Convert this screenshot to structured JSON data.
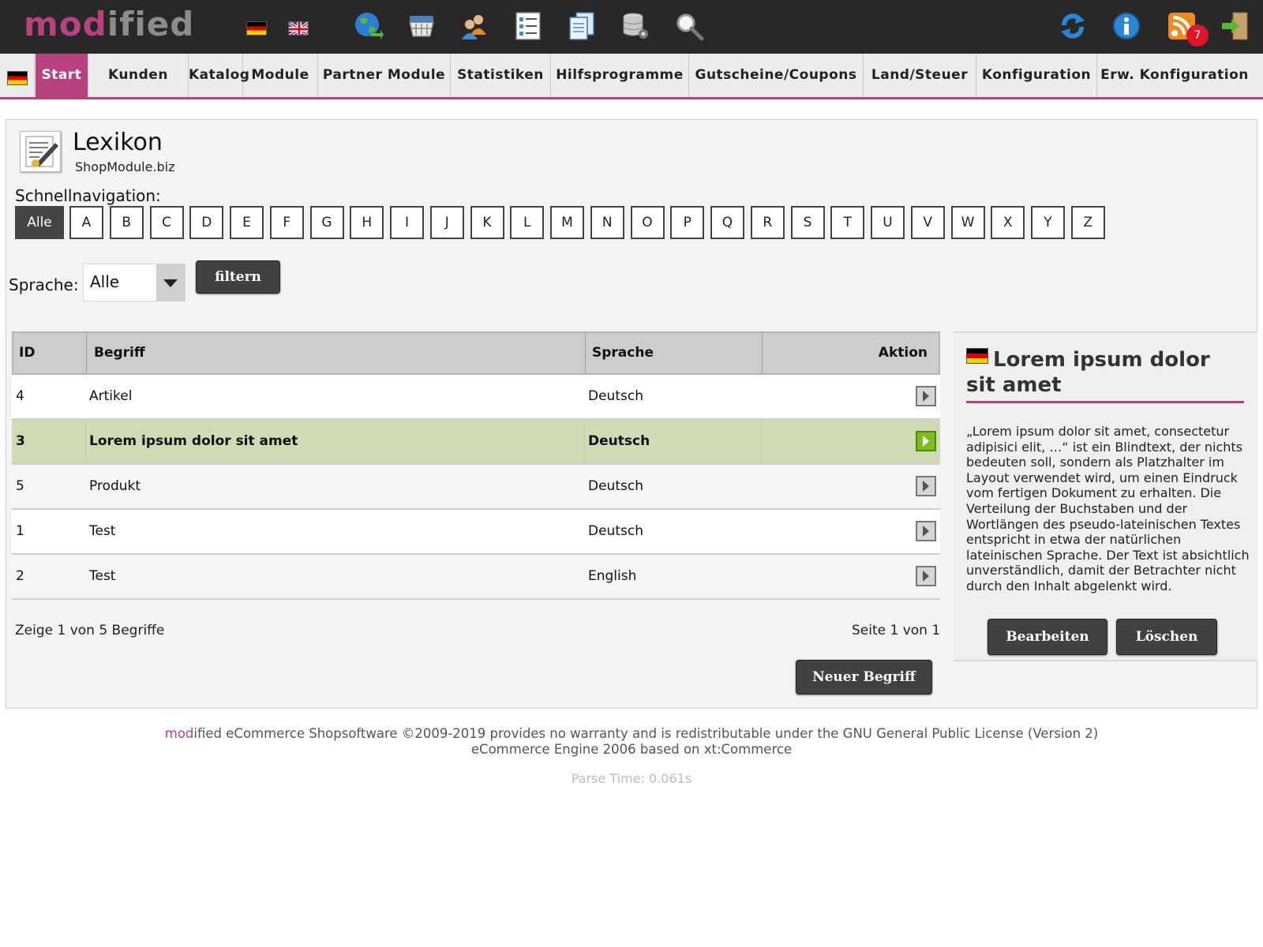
{
  "header": {
    "logo_mod": "mod",
    "logo_ified": "ified",
    "notification_count": "7",
    "icons": [
      "de-flag-icon",
      "uk-flag-icon",
      "globe-icon",
      "basket-icon",
      "users-icon",
      "checklist-icon",
      "documents-icon",
      "database-settings-icon",
      "search-icon",
      "refresh-icon",
      "info-icon",
      "rss-icon",
      "logout-icon"
    ]
  },
  "menu": {
    "items": [
      "Start",
      "Kunden",
      "Katalog",
      "Module",
      "Partner Module",
      "Statistiken",
      "Hilfsprogramme",
      "Gutscheine/Coupons",
      "Land/Steuer",
      "Konfiguration",
      "Erw. Konfiguration"
    ],
    "active": "Start"
  },
  "page": {
    "title": "Lexikon",
    "subtitle": "ShopModule.biz",
    "quicknav_label": "Schnellnavigation:",
    "letters": [
      "Alle",
      "A",
      "B",
      "C",
      "D",
      "E",
      "F",
      "G",
      "H",
      "I",
      "J",
      "K",
      "L",
      "M",
      "N",
      "O",
      "P",
      "Q",
      "R",
      "S",
      "T",
      "U",
      "V",
      "W",
      "X",
      "Y",
      "Z"
    ],
    "language_label": "Sprache:",
    "language_value": "Alle",
    "filter_button": "filtern"
  },
  "table": {
    "columns": [
      "ID",
      "Begriff",
      "Sprache",
      "Aktion"
    ],
    "rows": [
      {
        "id": "4",
        "term": "Artikel",
        "lang": "Deutsch"
      },
      {
        "id": "3",
        "term": "Lorem ipsum dolor sit amet",
        "lang": "Deutsch"
      },
      {
        "id": "5",
        "term": "Produkt",
        "lang": "Deutsch"
      },
      {
        "id": "1",
        "term": "Test",
        "lang": "Deutsch"
      },
      {
        "id": "2",
        "term": "Test",
        "lang": "English"
      }
    ],
    "summary": "Zeige 1 von 5 Begriffe",
    "pagination": "Seite 1 von 1",
    "new_button": "Neuer Begriff"
  },
  "detail": {
    "title": "Lorem ipsum dolor sit amet",
    "text": "„Lorem ipsum dolor sit amet, consectetur adipisici elit, …“ ist ein Blindtext, der nichts bedeuten soll, sondern als Platzhalter im Layout verwendet wird, um einen Eindruck vom fertigen Dokument zu erhalten. Die Verteilung der Buchstaben und der Wortlängen des pseudo-lateinischen Textes entspricht in etwa der natürlichen lateinischen Sprache. Der Text ist absichtlich unverständlich, damit der Betrachter nicht durch den Inhalt abgelenkt wird.",
    "edit_button": "Bearbeiten",
    "delete_button": "Löschen"
  },
  "footer": {
    "line1_mod": "mod",
    "line1_rest": "ified eCommerce Shopsoftware ©2009-2019 provides no warranty and is redistributable under the GNU General Public License (Version 2)",
    "line2": "eCommerce Engine 2006 based on xt:Commerce",
    "parse_time": "Parse Time: 0.061s"
  },
  "colors": {
    "brand": "#b8417f",
    "topbar": "#282828",
    "selected_row": "#d0dab5",
    "button_dark": "#414141"
  }
}
